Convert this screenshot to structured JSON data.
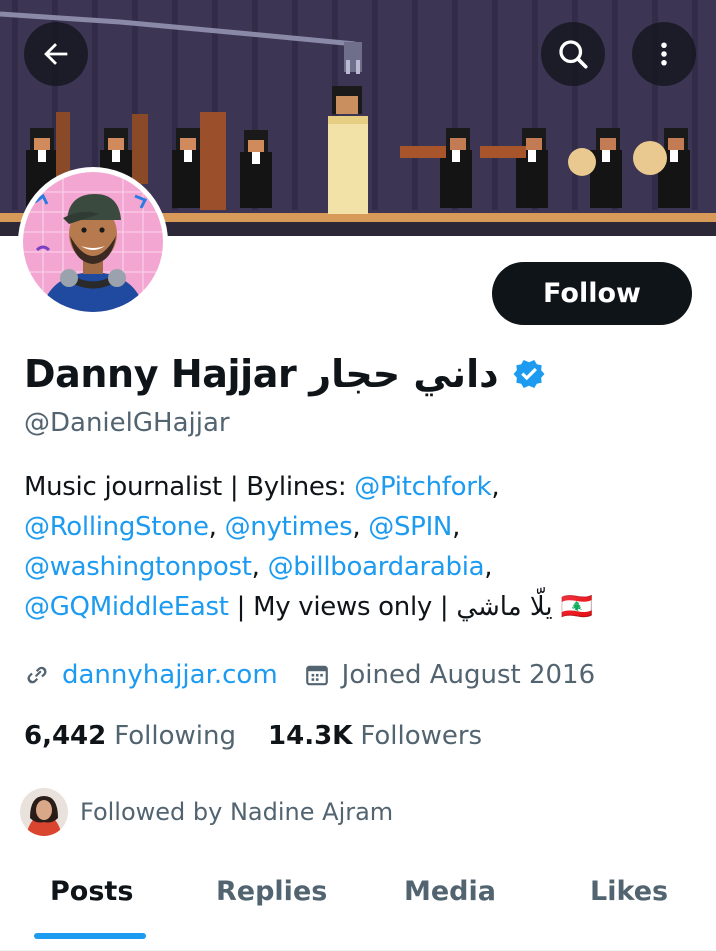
{
  "profile": {
    "display_name": "Danny Hajjar داني حجار",
    "handle": "@DanielGHajjar",
    "verified": true,
    "follow_label": "Follow",
    "bio": {
      "line1_text": "Music journalist | Bylines: ",
      "line1_mention": "@Pitchfork",
      "line1_tail": ",",
      "line2_mention1": "@RollingStone",
      "line2_sep1": ", ",
      "line2_mention2": "@nytimes",
      "line2_sep2": ", ",
      "line2_mention3": "@SPIN",
      "line2_tail": ",",
      "line3_mention1": "@washingtonpost",
      "line3_sep": ", ",
      "line3_mention2": "@billboardarabia",
      "line3_tail": ",",
      "line4_mention": "@GQMiddleEast",
      "line4_text": " | My views only | يلّا ماشي 🇱🇧"
    },
    "website": "dannyhajjar.com",
    "joined": "Joined August 2016",
    "following_count": "6,442",
    "following_label": "Following",
    "followers_count": "14.3K",
    "followers_label": "Followers",
    "followed_by": "Followed by Nadine Ajram"
  },
  "header_icons": {
    "back": "back-arrow-icon",
    "search": "search-icon",
    "more": "more-vertical-icon"
  },
  "tabs": [
    {
      "label": "Posts",
      "active": true
    },
    {
      "label": "Replies",
      "active": false
    },
    {
      "label": "Media",
      "active": false
    },
    {
      "label": "Likes",
      "active": false
    }
  ],
  "colors": {
    "accent": "#1d9bf0",
    "text": "#0f1419",
    "muted": "#536471",
    "banner_bg": "#3d3554"
  }
}
